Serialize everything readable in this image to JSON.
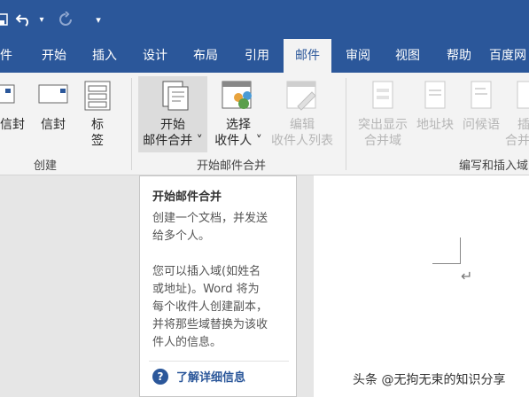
{
  "qat": {
    "customize_glyph": "▾"
  },
  "tabs": [
    "件",
    "开始",
    "插入",
    "设计",
    "布局",
    "引用",
    "邮件",
    "审阅",
    "视图",
    "帮助",
    "百度网"
  ],
  "ribbon": {
    "create": {
      "label": "创建",
      "envelope1": "信封",
      "envelope2": "信封",
      "labels_line1": "标",
      "labels_line2": "签"
    },
    "start": {
      "label": "开始邮件合并",
      "start_merge_line1": "开始",
      "start_merge_line2": "邮件合并 ˅",
      "select_recipients_line1": "选择",
      "select_recipients_line2": "收件人 ˅",
      "edit_list_line1": "编辑",
      "edit_list_line2": "收件人列表"
    },
    "write": {
      "label": "编写和插入域",
      "highlight_line1": "突出显示",
      "highlight_line2": "合并域",
      "address_block": "地址块",
      "greeting": "问候语",
      "insert_line1": "插",
      "insert_line2": "合并"
    }
  },
  "tooltip": {
    "title": "开始邮件合并",
    "para1": "创建一个文档，并发送\n给多个人。",
    "para2": "您可以插入域(如姓名\n或地址)。Word 将为\n每个收件人创建副本，\n并将那些域替换为该收\n件人的信息。",
    "help": "了解详细信息"
  },
  "document": {
    "paragraph_mark": "↵"
  },
  "watermark": "头条 @无拘无束的知识分享",
  "colors": {
    "accent": "#2b579a",
    "ribbon": "#f3f3f3"
  }
}
